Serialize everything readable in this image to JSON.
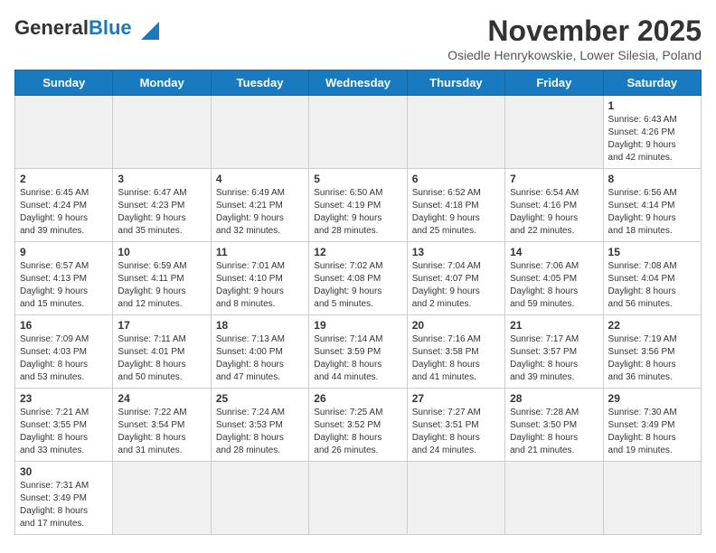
{
  "header": {
    "logo_general": "General",
    "logo_blue": "Blue",
    "month_title": "November 2025",
    "subtitle": "Osiedle Henrykowskie, Lower Silesia, Poland"
  },
  "days_of_week": [
    "Sunday",
    "Monday",
    "Tuesday",
    "Wednesday",
    "Thursday",
    "Friday",
    "Saturday"
  ],
  "weeks": [
    [
      {
        "day": "",
        "info": "",
        "empty": true
      },
      {
        "day": "",
        "info": "",
        "empty": true
      },
      {
        "day": "",
        "info": "",
        "empty": true
      },
      {
        "day": "",
        "info": "",
        "empty": true
      },
      {
        "day": "",
        "info": "",
        "empty": true
      },
      {
        "day": "",
        "info": "",
        "empty": true
      },
      {
        "day": "1",
        "info": "Sunrise: 6:43 AM\nSunset: 4:26 PM\nDaylight: 9 hours\nand 42 minutes."
      }
    ],
    [
      {
        "day": "2",
        "info": "Sunrise: 6:45 AM\nSunset: 4:24 PM\nDaylight: 9 hours\nand 39 minutes."
      },
      {
        "day": "3",
        "info": "Sunrise: 6:47 AM\nSunset: 4:23 PM\nDaylight: 9 hours\nand 35 minutes."
      },
      {
        "day": "4",
        "info": "Sunrise: 6:49 AM\nSunset: 4:21 PM\nDaylight: 9 hours\nand 32 minutes."
      },
      {
        "day": "5",
        "info": "Sunrise: 6:50 AM\nSunset: 4:19 PM\nDaylight: 9 hours\nand 28 minutes."
      },
      {
        "day": "6",
        "info": "Sunrise: 6:52 AM\nSunset: 4:18 PM\nDaylight: 9 hours\nand 25 minutes."
      },
      {
        "day": "7",
        "info": "Sunrise: 6:54 AM\nSunset: 4:16 PM\nDaylight: 9 hours\nand 22 minutes."
      },
      {
        "day": "8",
        "info": "Sunrise: 6:56 AM\nSunset: 4:14 PM\nDaylight: 9 hours\nand 18 minutes."
      }
    ],
    [
      {
        "day": "9",
        "info": "Sunrise: 6:57 AM\nSunset: 4:13 PM\nDaylight: 9 hours\nand 15 minutes."
      },
      {
        "day": "10",
        "info": "Sunrise: 6:59 AM\nSunset: 4:11 PM\nDaylight: 9 hours\nand 12 minutes."
      },
      {
        "day": "11",
        "info": "Sunrise: 7:01 AM\nSunset: 4:10 PM\nDaylight: 9 hours\nand 8 minutes."
      },
      {
        "day": "12",
        "info": "Sunrise: 7:02 AM\nSunset: 4:08 PM\nDaylight: 9 hours\nand 5 minutes."
      },
      {
        "day": "13",
        "info": "Sunrise: 7:04 AM\nSunset: 4:07 PM\nDaylight: 9 hours\nand 2 minutes."
      },
      {
        "day": "14",
        "info": "Sunrise: 7:06 AM\nSunset: 4:05 PM\nDaylight: 8 hours\nand 59 minutes."
      },
      {
        "day": "15",
        "info": "Sunrise: 7:08 AM\nSunset: 4:04 PM\nDaylight: 8 hours\nand 56 minutes."
      }
    ],
    [
      {
        "day": "16",
        "info": "Sunrise: 7:09 AM\nSunset: 4:03 PM\nDaylight: 8 hours\nand 53 minutes."
      },
      {
        "day": "17",
        "info": "Sunrise: 7:11 AM\nSunset: 4:01 PM\nDaylight: 8 hours\nand 50 minutes."
      },
      {
        "day": "18",
        "info": "Sunrise: 7:13 AM\nSunset: 4:00 PM\nDaylight: 8 hours\nand 47 minutes."
      },
      {
        "day": "19",
        "info": "Sunrise: 7:14 AM\nSunset: 3:59 PM\nDaylight: 8 hours\nand 44 minutes."
      },
      {
        "day": "20",
        "info": "Sunrise: 7:16 AM\nSunset: 3:58 PM\nDaylight: 8 hours\nand 41 minutes."
      },
      {
        "day": "21",
        "info": "Sunrise: 7:17 AM\nSunset: 3:57 PM\nDaylight: 8 hours\nand 39 minutes."
      },
      {
        "day": "22",
        "info": "Sunrise: 7:19 AM\nSunset: 3:56 PM\nDaylight: 8 hours\nand 36 minutes."
      }
    ],
    [
      {
        "day": "23",
        "info": "Sunrise: 7:21 AM\nSunset: 3:55 PM\nDaylight: 8 hours\nand 33 minutes."
      },
      {
        "day": "24",
        "info": "Sunrise: 7:22 AM\nSunset: 3:54 PM\nDaylight: 8 hours\nand 31 minutes."
      },
      {
        "day": "25",
        "info": "Sunrise: 7:24 AM\nSunset: 3:53 PM\nDaylight: 8 hours\nand 28 minutes."
      },
      {
        "day": "26",
        "info": "Sunrise: 7:25 AM\nSunset: 3:52 PM\nDaylight: 8 hours\nand 26 minutes."
      },
      {
        "day": "27",
        "info": "Sunrise: 7:27 AM\nSunset: 3:51 PM\nDaylight: 8 hours\nand 24 minutes."
      },
      {
        "day": "28",
        "info": "Sunrise: 7:28 AM\nSunset: 3:50 PM\nDaylight: 8 hours\nand 21 minutes."
      },
      {
        "day": "29",
        "info": "Sunrise: 7:30 AM\nSunset: 3:49 PM\nDaylight: 8 hours\nand 19 minutes."
      }
    ],
    [
      {
        "day": "30",
        "info": "Sunrise: 7:31 AM\nSunset: 3:49 PM\nDaylight: 8 hours\nand 17 minutes."
      },
      {
        "day": "",
        "info": "",
        "empty": true
      },
      {
        "day": "",
        "info": "",
        "empty": true
      },
      {
        "day": "",
        "info": "",
        "empty": true
      },
      {
        "day": "",
        "info": "",
        "empty": true
      },
      {
        "day": "",
        "info": "",
        "empty": true
      },
      {
        "day": "",
        "info": "",
        "empty": true
      }
    ]
  ]
}
